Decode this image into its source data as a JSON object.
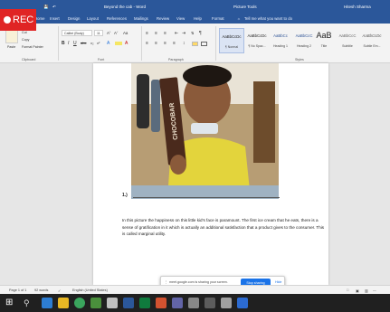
{
  "titlebar": {
    "document_title": "Beyond the cab - Word",
    "picture_tools": "Picture Tools",
    "user_name": "Hitesh Sharma"
  },
  "ribbon_tabs": [
    "Home",
    "Insert",
    "Design",
    "Layout",
    "References",
    "Mailings",
    "Review",
    "View",
    "Help",
    "Format"
  ],
  "tell_me": "Tell me what you want to do",
  "clipboard": {
    "paste": "Paste",
    "cut": "Cut",
    "copy": "Copy",
    "format_painter": "Format Painter",
    "label": "Clipboard"
  },
  "font": {
    "name": "Calibri (Body)",
    "size": "11",
    "label": "Font"
  },
  "paragraph": {
    "label": "Paragraph"
  },
  "styles": {
    "items": [
      {
        "sample": "AaBbCcDc",
        "name": "¶ Normal"
      },
      {
        "sample": "AaBbCcDc",
        "name": "¶ No Spac..."
      },
      {
        "sample": "AaBbCc",
        "name": "Heading 1"
      },
      {
        "sample": "AaBbCcC",
        "name": "Heading 2"
      },
      {
        "sample": "AaB",
        "name": "Title"
      },
      {
        "sample": "AaBbCcC",
        "name": "Subtitle"
      },
      {
        "sample": "AaBbCcDc",
        "name": "Subtle Em..."
      }
    ],
    "label": "Styles"
  },
  "document": {
    "caption_number": "1.)",
    "body_text": "In this picture the happiness on this little kid's face is paramount. The first ice cream that he eats, there is a sense of gratification in it which is actually an additional satisfaction that a product gives to the consumer. This is called marginal utility.",
    "chocolate_text": "CHOCOBAR"
  },
  "statusbar": {
    "page": "Page 1 of 1",
    "words": "92 words",
    "language": "English (United States)"
  },
  "share_banner": {
    "message": "meet.google.com is sharing your screen.",
    "stop_label": "Stop sharing",
    "hide_label": "Hide"
  },
  "rec_label": "REC",
  "colors": {
    "word_blue": "#2b579a",
    "rec_red": "#e02424",
    "stop_blue": "#1a73e8"
  }
}
